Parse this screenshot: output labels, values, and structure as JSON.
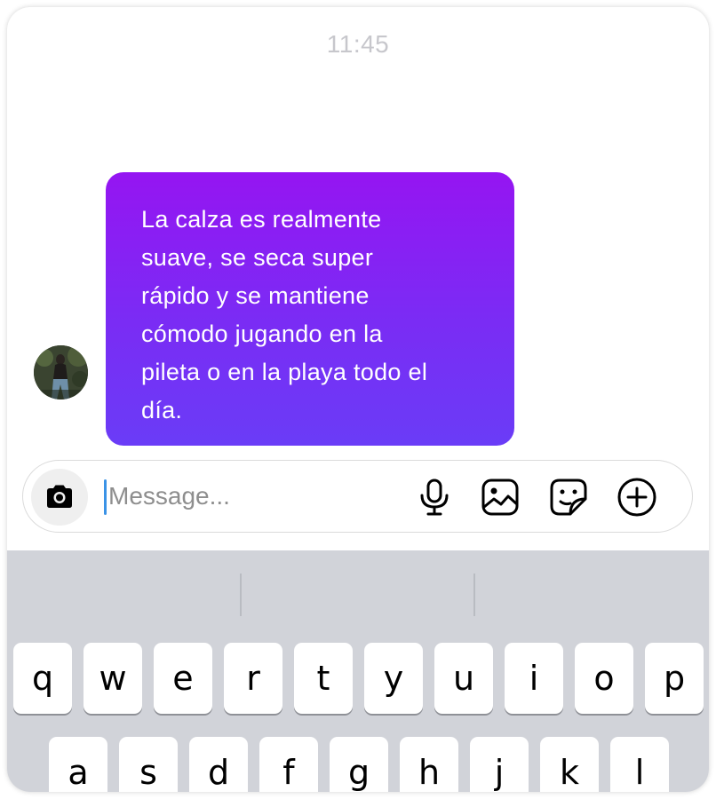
{
  "chat": {
    "timestamp": "11:45",
    "message": {
      "lines": [
        "La calza es realmente",
        "suave, se seca super",
        "rápido y se mantiene",
        "cómodo jugando en la",
        "pileta o en la playa todo el",
        "día."
      ]
    }
  },
  "composer": {
    "placeholder": "Message...",
    "icons": [
      "camera-icon",
      "microphone-icon",
      "gallery-icon",
      "sticker-icon",
      "plus-icon"
    ]
  },
  "keyboard": {
    "row1": [
      "q",
      "w",
      "e",
      "r",
      "t",
      "y",
      "u",
      "i",
      "o",
      "p"
    ],
    "row2": [
      "a",
      "s",
      "d",
      "f",
      "g",
      "h",
      "j",
      "k",
      "l"
    ]
  },
  "colors": {
    "bubble_top": "#9515f2",
    "bubble_bottom": "#6a3cf7",
    "keyboard_bg": "#d1d3d9",
    "cursor": "#3b93e6"
  }
}
